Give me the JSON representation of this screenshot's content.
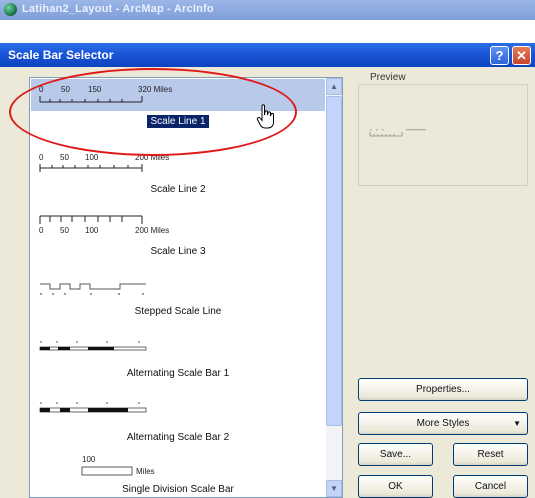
{
  "app": {
    "title": "Latihan2_Layout - ArcMap - ArcInfo"
  },
  "dialog": {
    "title": "Scale Bar Selector",
    "help_glyph": "?",
    "close_glyph": "✕"
  },
  "styles": [
    {
      "label": "Scale Line 1",
      "selected": true,
      "ticks": [
        "0",
        "50",
        "150",
        "320 Miles"
      ]
    },
    {
      "label": "Scale Line 2",
      "selected": false,
      "ticks": [
        "0",
        "50",
        "100",
        "200 Miles"
      ]
    },
    {
      "label": "Scale Line 3",
      "selected": false,
      "ticks": [
        "0",
        "50",
        "100",
        "200 Miles"
      ]
    },
    {
      "label": "Stepped Scale Line",
      "selected": false
    },
    {
      "label": "Alternating Scale Bar 1",
      "selected": false
    },
    {
      "label": "Alternating Scale Bar 2",
      "selected": false
    },
    {
      "label": "Single Division Scale Bar",
      "selected": false,
      "ticks": [
        "100",
        "Miles"
      ]
    }
  ],
  "preview": {
    "title": "Preview"
  },
  "buttons": {
    "properties": "Properties...",
    "more_styles": "More Styles",
    "save": "Save...",
    "reset": "Reset",
    "ok": "OK",
    "cancel": "Cancel"
  },
  "scroll": {
    "up": "▲",
    "down": "▼"
  },
  "colors": {
    "titlebar": "#1a56d8",
    "selection": "#0a246a",
    "annotation": "#e01818"
  }
}
